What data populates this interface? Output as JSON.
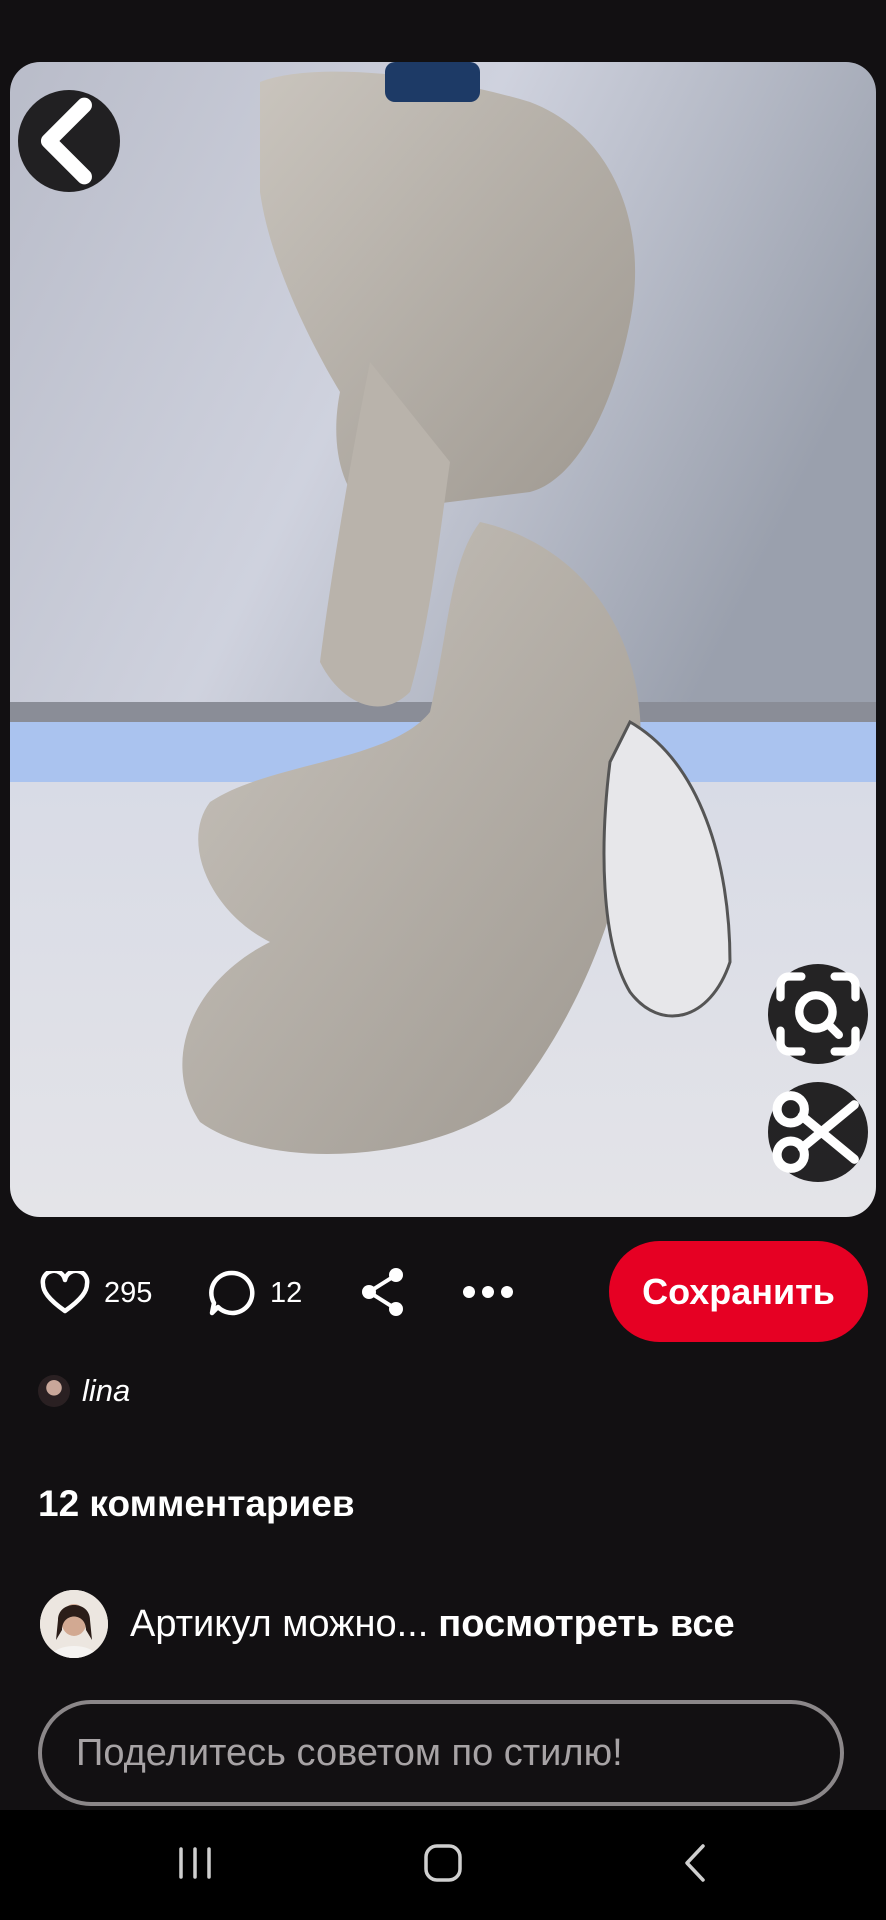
{
  "pin": {
    "image_description_icon": "photo",
    "like_count": "295",
    "comment_count": "12",
    "save_label": "Сохранить"
  },
  "author": {
    "name": "lina"
  },
  "comments": {
    "title": "12 комментариев",
    "preview_text": "Артикул можно...",
    "see_all_label": "посмотреть все"
  },
  "input": {
    "placeholder": "Поделитесь советом по стилю!"
  },
  "icons": {
    "back": "chevron-left-icon",
    "lens": "visual-search-icon",
    "cut": "scissors-icon",
    "like": "heart-icon",
    "comment": "speech-bubble-icon",
    "share": "share-icon",
    "more": "more-horizontal-icon"
  },
  "colors": {
    "background": "#121012",
    "save_button": "#e60023",
    "navbar": "#000000"
  }
}
